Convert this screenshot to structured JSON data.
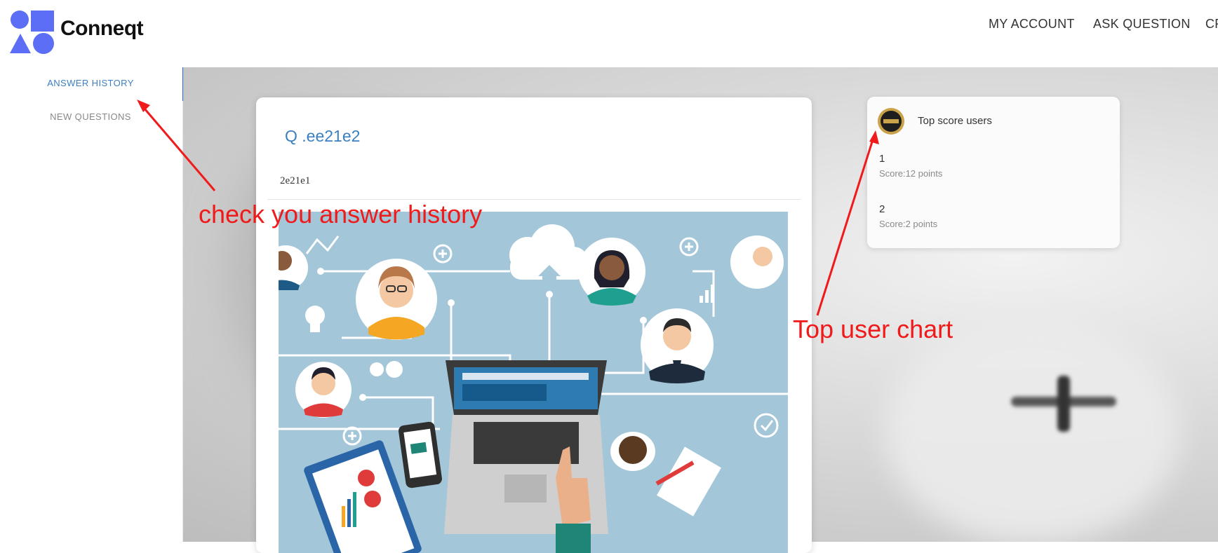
{
  "header": {
    "brand": "Conneqt",
    "nav": [
      "MY ACCOUNT",
      "ASK QUESTION",
      "CR"
    ]
  },
  "sidebar": {
    "items": [
      {
        "label": "ANSWER HISTORY",
        "active": true
      },
      {
        "label": "NEW QUESTIONS",
        "active": false
      }
    ]
  },
  "question": {
    "title": "Q .ee21e2",
    "body": "2e21e1"
  },
  "top_users": {
    "title": "Top score users",
    "users": [
      {
        "rank": "1",
        "score": "Score:12 points"
      },
      {
        "rank": "2",
        "score": "Score:2 points"
      }
    ]
  },
  "annotations": {
    "history": "check you answer history",
    "chart": "Top user chart"
  },
  "colors": {
    "accent": "#3a7fc1",
    "logo": "#5b6ef5",
    "annotation": "#f01a1a"
  }
}
